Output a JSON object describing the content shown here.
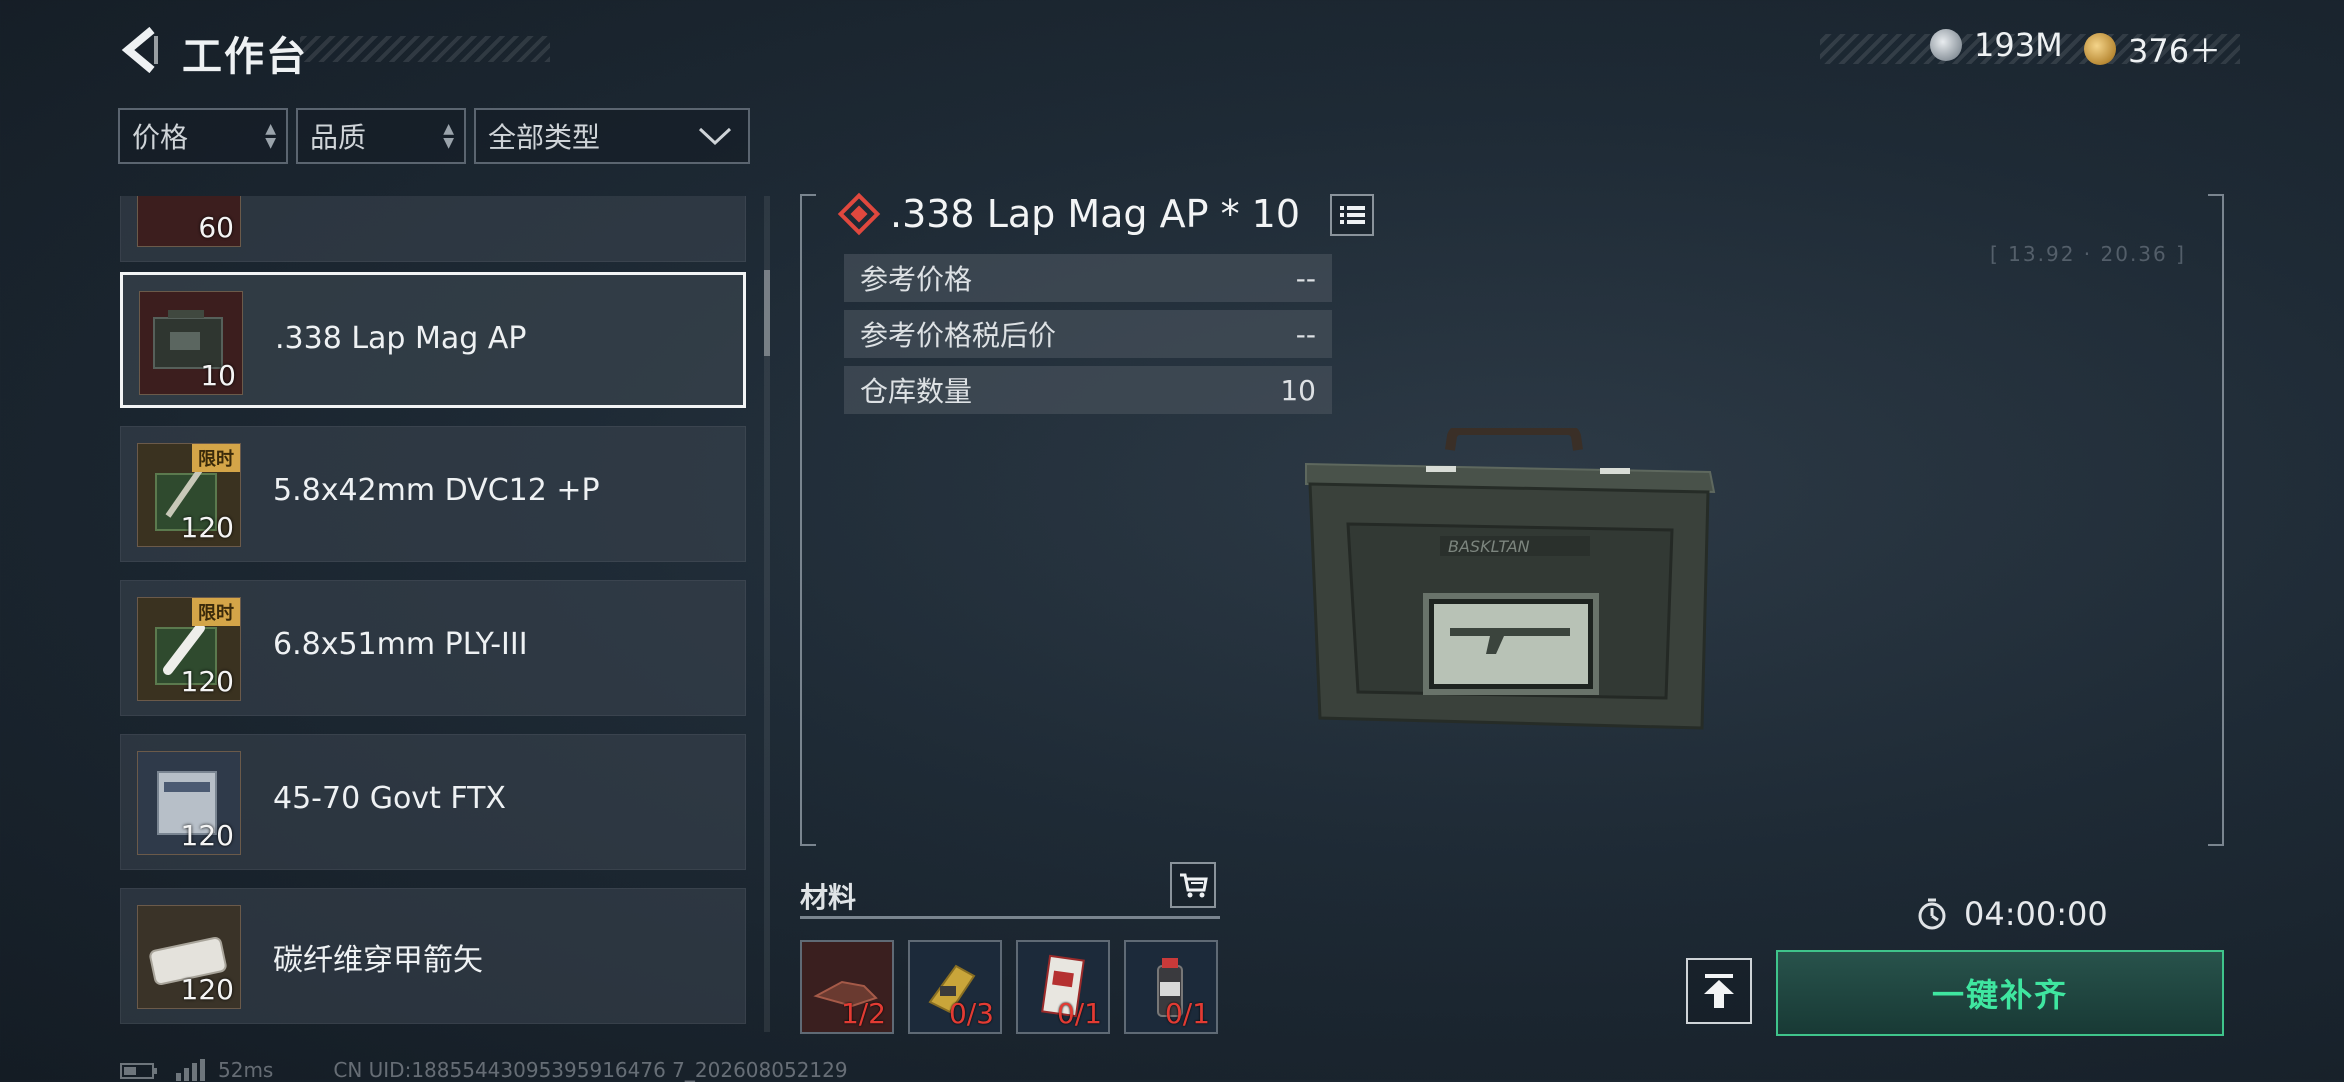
{
  "header": {
    "title": "工作台",
    "currency": [
      {
        "icon": "silver-coin-icon",
        "value": "193M"
      },
      {
        "icon": "gold-triangle-coin-icon",
        "value": "376＋"
      }
    ]
  },
  "filters": {
    "price": "价格",
    "quality": "品质",
    "type": "全部类型"
  },
  "items": [
    {
      "name": "",
      "qty": "60",
      "tag": ""
    },
    {
      "name": ".338 Lap Mag AP",
      "qty": "10",
      "tag": "",
      "selected": true
    },
    {
      "name": "5.8x42mm DVC12 +P",
      "qty": "120",
      "tag": "限时"
    },
    {
      "name": "6.8x51mm PLY-III",
      "qty": "120",
      "tag": "限时"
    },
    {
      "name": "45-70 Govt FTX",
      "qty": "120",
      "tag": ""
    },
    {
      "name": "碳纤维穿甲箭矢",
      "qty": "120",
      "tag": ""
    }
  ],
  "detail": {
    "title": ".338 Lap Mag AP * 10",
    "rows": [
      {
        "label": "参考价格",
        "value": "--"
      },
      {
        "label": "参考价格税后价",
        "value": "--"
      },
      {
        "label": "仓库数量",
        "value": "10"
      }
    ],
    "coords": "[ 13.92 · 20.36 ]"
  },
  "materials": {
    "label": "材料",
    "items": [
      {
        "icon": "material-weapon-part-icon",
        "count": "1/2"
      },
      {
        "icon": "material-tool-icon",
        "count": "0/3"
      },
      {
        "icon": "material-card-icon",
        "count": "0/1"
      },
      {
        "icon": "material-canister-icon",
        "count": "0/1"
      }
    ]
  },
  "timer": "04:00:00",
  "refill_label": "一键补齐",
  "status": {
    "ping": "52ms",
    "uid": "CN UID:18855443095395916476 7_202608052129"
  },
  "colors": {
    "accent_green": "#3fe6a0",
    "quality_red": "#e0483e",
    "limited_tag": "#d4a548"
  }
}
